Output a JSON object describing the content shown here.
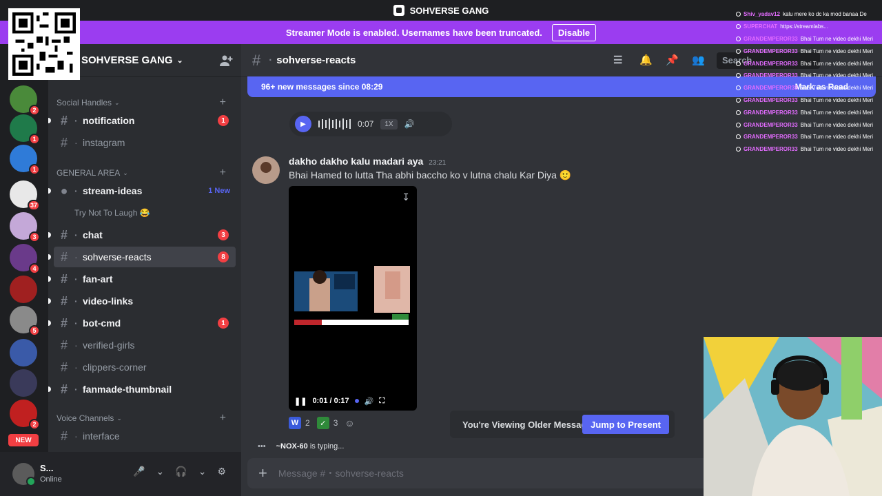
{
  "window": {
    "title": "SOHVERSE GANG"
  },
  "streamer_banner": {
    "text": "Streamer Mode is enabled. Usernames have been truncated.",
    "button": "Disable"
  },
  "servers": [
    {
      "badge": "2",
      "color": "#4a8a3a"
    },
    {
      "badge": "1",
      "color": "#1f7a4a"
    },
    {
      "badge": "1",
      "color": "#2f7bd8"
    },
    {
      "badge": "37",
      "color": "#e8e8e8"
    },
    {
      "badge": "3",
      "color": "#c4a8d8"
    },
    {
      "badge": "4",
      "color": "#6a3a8a"
    },
    {
      "badge": "",
      "color": "#a02020"
    },
    {
      "badge": "5",
      "color": "#8a8a8a"
    },
    {
      "badge": "",
      "color": "#3a5aa8"
    },
    {
      "badge": "",
      "color": "#3a3a5a"
    },
    {
      "badge": "2",
      "color": "#c02020"
    }
  ],
  "new_pill": "NEW",
  "sidebar": {
    "guild_name": "SOHVERSE GANG",
    "categories": [
      {
        "label": "Social Handles"
      },
      {
        "label": "GENERAL AREA"
      },
      {
        "label": "Voice Channels"
      }
    ],
    "channels": [
      {
        "name": "notification",
        "badge": "1"
      },
      {
        "name": "instagram"
      },
      {
        "name": "stream-ideas",
        "newlabel": "1 New"
      },
      {
        "name": "Try Not To Laugh 😂"
      },
      {
        "name": "chat",
        "badge": "3"
      },
      {
        "name": "sohverse-reacts",
        "badge": "8"
      },
      {
        "name": "fan-art"
      },
      {
        "name": "video-links"
      },
      {
        "name": "bot-cmd",
        "badge": "1"
      },
      {
        "name": "verified-girls"
      },
      {
        "name": "clippers-corner"
      },
      {
        "name": "fanmade-thumbnail"
      },
      {
        "name": "interface"
      }
    ]
  },
  "user": {
    "name": "S...",
    "status": "Online"
  },
  "channel_header": {
    "name": "sohverse-reacts",
    "search": "Search"
  },
  "new_messages_bar": {
    "text": "96+ new messages since 08:29",
    "mark": "Mark as Read"
  },
  "voice_message": {
    "duration": "0:07",
    "speed": "1X"
  },
  "message": {
    "author": "dakho dakho kalu madari aya",
    "time": "23:21",
    "text": "Bhai Hamed to lutta Tha abhi baccho ko v lutna chalu Kar Diya 🙂",
    "video_time": "0:01 / 0:17"
  },
  "reactions": [
    {
      "count": "2",
      "emoji": "W"
    },
    {
      "count": "3",
      "emoji": "✓"
    }
  ],
  "typing": {
    "user": "~NOX-60",
    "text": "is typing..."
  },
  "older_notice": {
    "text": "You're Viewing Older Messages",
    "button": "Jump to Present"
  },
  "composer": {
    "placeholder": "Message #・sohverse-reacts"
  },
  "stream_chat": [
    {
      "user": "Shiv_yadav12",
      "text": "kalu mere ko dc ka mod banaa De"
    },
    {
      "user": "SUPERCHAT",
      "text": "https://streamlabs..."
    },
    {
      "user": "GRANDEMPEROR33",
      "text": "Bhai Tum ne video dekhi Meri"
    },
    {
      "user": "GRANDEMPEROR33",
      "text": "Bhai Tum ne video dekhi Meri"
    },
    {
      "user": "GRANDEMPEROR33",
      "text": "Bhai Tum ne video dekhi Meri"
    },
    {
      "user": "GRANDEMPEROR33",
      "text": "Bhai Tum ne video dekhi Meri"
    },
    {
      "user": "GRANDEMPEROR33",
      "text": "Bhai Tum ne video dekhi Meri"
    },
    {
      "user": "GRANDEMPEROR33",
      "text": "Bhai Tum ne video dekhi Meri"
    },
    {
      "user": "GRANDEMPEROR33",
      "text": "Bhai Tum ne video dekhi Meri"
    },
    {
      "user": "GRANDEMPEROR33",
      "text": "Bhai Tum ne video dekhi Meri"
    },
    {
      "user": "GRANDEMPEROR33",
      "text": "Bhai Tum ne video dekhi Meri"
    },
    {
      "user": "GRANDEMPEROR33",
      "text": "Bhai Tum ne video dekhi Meri"
    }
  ],
  "colors": {
    "accent": "#5865f2",
    "streamer": "#9b3df0",
    "mention": "#f23f43"
  }
}
